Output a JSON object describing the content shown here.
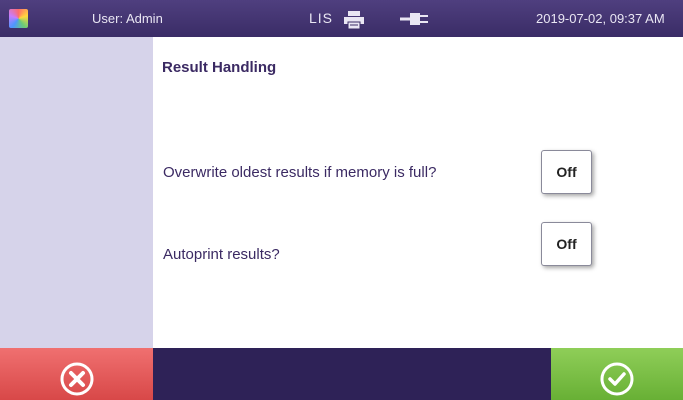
{
  "header": {
    "user_label": "User: Admin",
    "lis_label": "LIS",
    "datetime": "2019-07-02, 09:37 AM",
    "icons": [
      "app-logo-icon",
      "printer-icon",
      "power-plug-icon"
    ]
  },
  "main": {
    "title": "Result Handling",
    "settings": [
      {
        "label": "Overwrite oldest results if memory is full?",
        "value": "Off"
      },
      {
        "label": "Autoprint results?",
        "value": "Off"
      }
    ]
  },
  "footer": {
    "cancel_icon": "cancel-x-icon",
    "confirm_icon": "confirm-check-icon"
  },
  "colors": {
    "header_bg": "#3a2c66",
    "sidebar_bg": "#d6d3ea",
    "text": "#3b2a63",
    "cancel": "#e05a5a",
    "confirm": "#7cc046"
  }
}
